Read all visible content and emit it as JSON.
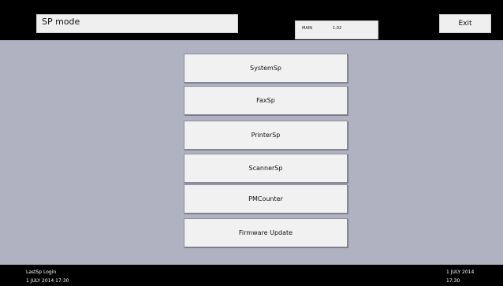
{
  "header": {
    "title": "SP mode",
    "version_label": "MAIN",
    "version_value": "1.02",
    "exit_label": "Exit"
  },
  "menu": {
    "items": [
      "SystemSp",
      "FaxSp",
      "PrinterSp",
      "ScannerSp",
      "PMCounter",
      "Firmware Update"
    ]
  },
  "status": {
    "left_label": "LastSp Login",
    "left_datetime": "1 JULY 2014 17:30",
    "right_date": "1 JULY 2014",
    "right_time": "17:30"
  }
}
